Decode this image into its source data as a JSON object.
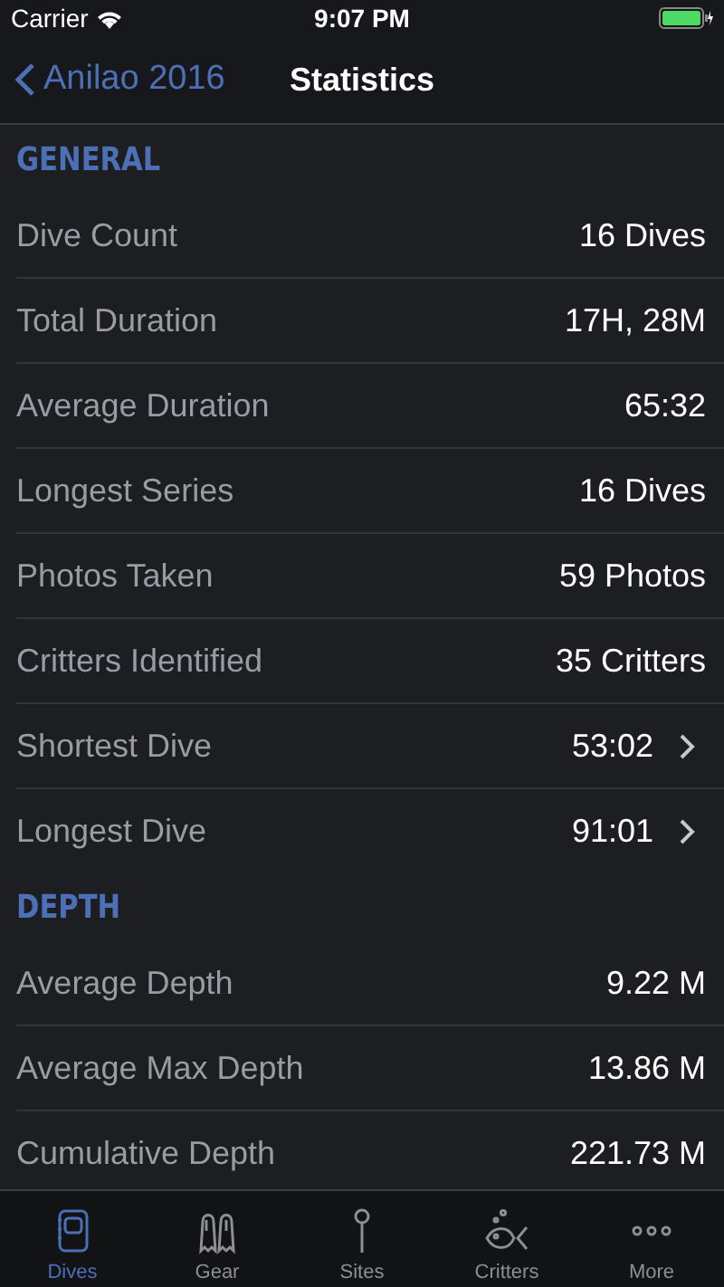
{
  "status_bar": {
    "carrier": "Carrier",
    "time": "9:07 PM"
  },
  "nav": {
    "back": "Anilao 2016",
    "title": "Statistics"
  },
  "sections": [
    {
      "title": "GENERAL",
      "rows": [
        {
          "label": "Dive Count",
          "value": "16 Dives",
          "disclosure": false
        },
        {
          "label": "Total Duration",
          "value": "17H, 28M",
          "disclosure": false
        },
        {
          "label": "Average Duration",
          "value": "65:32",
          "disclosure": false
        },
        {
          "label": "Longest Series",
          "value": "16 Dives",
          "disclosure": false
        },
        {
          "label": "Photos Taken",
          "value": "59 Photos",
          "disclosure": false
        },
        {
          "label": "Critters Identified",
          "value": "35 Critters",
          "disclosure": false
        },
        {
          "label": "Shortest Dive",
          "value": "53:02",
          "disclosure": true
        },
        {
          "label": "Longest Dive",
          "value": "91:01",
          "disclosure": true
        }
      ]
    },
    {
      "title": "DEPTH",
      "rows": [
        {
          "label": "Average Depth",
          "value": "9.22 M",
          "disclosure": false
        },
        {
          "label": "Average Max Depth",
          "value": "13.86 M",
          "disclosure": false
        },
        {
          "label": "Cumulative Depth",
          "value": "221.73 M",
          "disclosure": false
        }
      ]
    }
  ],
  "tabs": [
    {
      "label": "Dives",
      "kind": "logbook",
      "selected": true
    },
    {
      "label": "Gear",
      "kind": "fins",
      "selected": false
    },
    {
      "label": "Sites",
      "kind": "pin",
      "selected": false
    },
    {
      "label": "Critters",
      "kind": "fish",
      "selected": false
    },
    {
      "label": "More",
      "kind": "more",
      "selected": false
    }
  ]
}
